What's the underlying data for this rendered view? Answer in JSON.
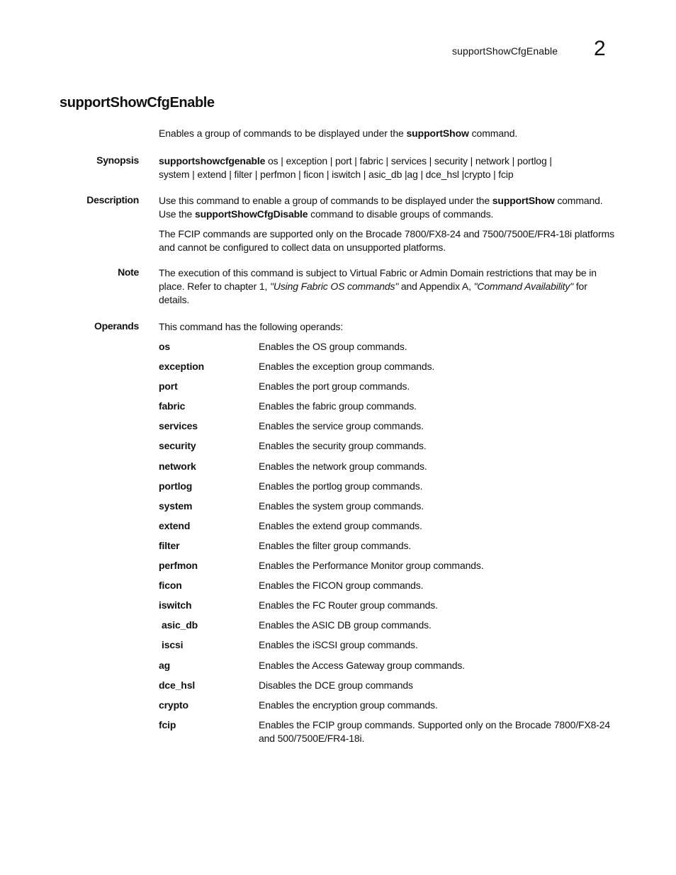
{
  "header": {
    "running_title": "supportShowCfgEnable",
    "chapter_number": "2"
  },
  "title": "supportShowCfgEnable",
  "intro": {
    "before": "Enables a group of commands to be displayed under the ",
    "bold": "supportShow",
    "after": " command."
  },
  "synopsis": {
    "label": "Synopsis",
    "command": "supportshowcfgenable",
    "args_line1": " os | exception | port | fabric | services | security | network | portlog |",
    "args_line2": "system | extend | filter | perfmon | ficon | iswitch | asic_db |ag | dce_hsl |crypto | fcip"
  },
  "description": {
    "label": "Description",
    "p1_a": "Use this command to enable a group of commands to be displayed under the ",
    "p1_b": "supportShow",
    "p1_c": " command. Use the ",
    "p1_d": "supportShowCfgDisable",
    "p1_e": " command to disable groups of commands.",
    "p2": "The FCIP commands are supported only on the Brocade 7800/FX8-24 and 7500/7500E/FR4-18i platforms and cannot be configured to collect data on unsupported platforms."
  },
  "note": {
    "label": "Note",
    "a": "The execution of this command is subject to Virtual Fabric or Admin Domain restrictions that may be in place. Refer to chapter 1, ",
    "b": "\"Using Fabric OS commands\"",
    "c": " and Appendix A, ",
    "d": "\"Command Availability\"",
    "e": " for details."
  },
  "operands": {
    "label": "Operands",
    "intro": "This command has the following operands:",
    "items": [
      {
        "name": "os",
        "desc": "Enables the OS group commands."
      },
      {
        "name": "exception",
        "desc": "Enables the exception group commands."
      },
      {
        "name": "port",
        "desc": "Enables the port group commands."
      },
      {
        "name": "fabric",
        "desc": "Enables the fabric group commands."
      },
      {
        "name": "services",
        "desc": "Enables the service group commands."
      },
      {
        "name": "security",
        "desc": "Enables the security group commands."
      },
      {
        "name": "network",
        "desc": "Enables the network group commands."
      },
      {
        "name": "portlog",
        "desc": "Enables the portlog group commands."
      },
      {
        "name": "system",
        "desc": "Enables the system group commands."
      },
      {
        "name": "extend",
        "desc": "Enables the extend group commands."
      },
      {
        "name": "filter",
        "desc": "Enables the filter group commands."
      },
      {
        "name": "perfmon",
        "desc": "Enables the Performance Monitor group commands."
      },
      {
        "name": "ficon",
        "desc": "Enables the FICON group commands."
      },
      {
        "name": "iswitch",
        "desc": "Enables the FC Router group commands."
      },
      {
        "name": "asic_db",
        "desc": "Enables the ASIC DB group commands."
      },
      {
        "name": "iscsi",
        "desc": "Enables the iSCSI group commands."
      },
      {
        "name": "ag",
        "desc": "Enables the Access Gateway group commands."
      },
      {
        "name": "dce_hsl",
        "desc": "Disables the DCE group commands"
      },
      {
        "name": "crypto",
        "desc": "Enables the encryption group commands."
      },
      {
        "name": "fcip",
        "desc": "Enables the FCIP group commands. Supported only on the Brocade 7800/FX8-24 and 500/7500E/FR4-18i."
      }
    ]
  }
}
